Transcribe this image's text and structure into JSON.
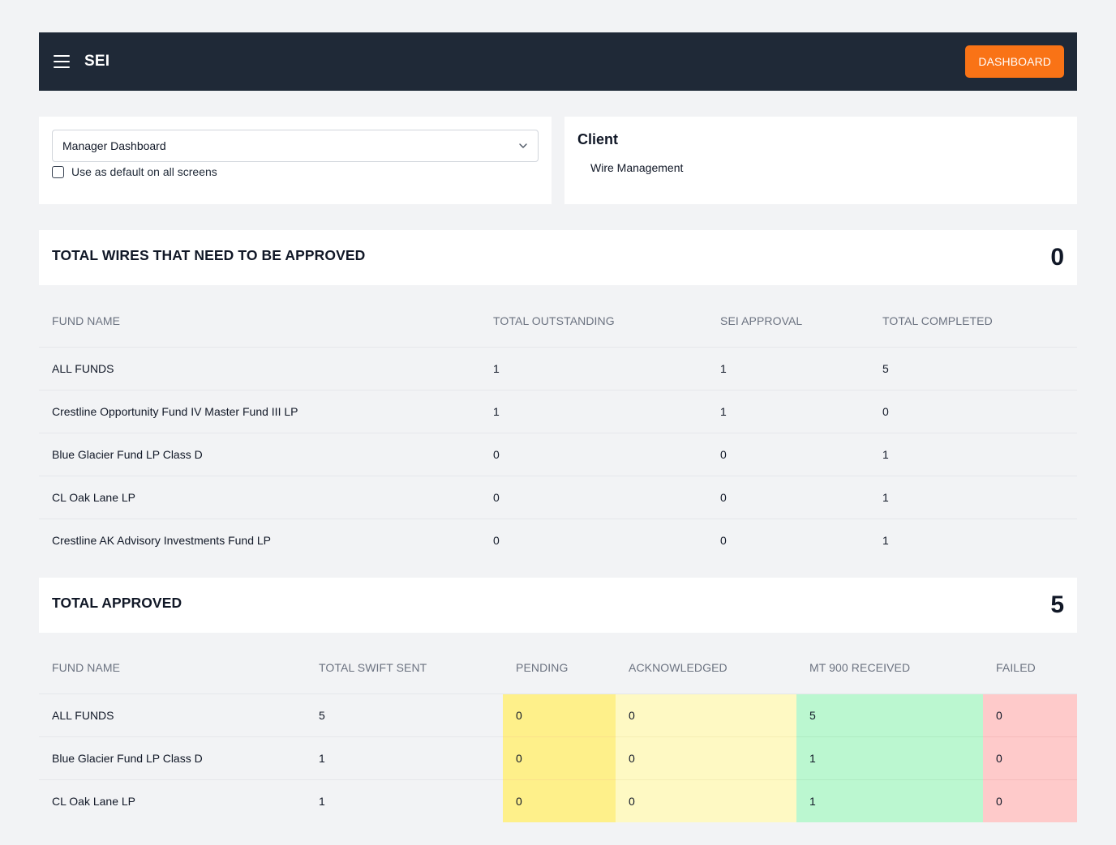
{
  "header": {
    "brand": "SEI",
    "menu_icon": "hamburger-menu-icon",
    "dashboard_label": "DASHBOARD",
    "bar_color": "#1f2937",
    "accent_color": "#f97316"
  },
  "view_selector": {
    "selected": "Manager Dashboard",
    "icon": "chevron-down-icon",
    "default_checkbox_label": "Use as default on all screens",
    "default_checked": false
  },
  "client_panel": {
    "title": "Client",
    "items": [
      "Wire Management"
    ]
  },
  "approval_section": {
    "title": "TOTAL WIRES THAT NEED TO BE APPROVED",
    "count": "0",
    "columns": [
      "FUND NAME",
      "TOTAL OUTSTANDING",
      "SEI APPROVAL",
      "TOTAL COMPLETED"
    ],
    "rows": [
      [
        "ALL FUNDS",
        "1",
        "1",
        "5"
      ],
      [
        "Crestline Opportunity Fund IV Master Fund III LP",
        "1",
        "1",
        "0"
      ],
      [
        "Blue Glacier Fund LP Class D",
        "0",
        "0",
        "1"
      ],
      [
        "CL Oak Lane LP",
        "0",
        "0",
        "1"
      ],
      [
        "Crestline AK Advisory Investments Fund LP",
        "0",
        "0",
        "1"
      ]
    ]
  },
  "approved_section": {
    "title": "TOTAL APPROVED",
    "count": "5",
    "columns": [
      "FUND NAME",
      "TOTAL SWIFT SENT",
      "PENDING",
      "ACKNOWLEDGED",
      "MT 900 RECEIVED",
      "FAILED"
    ],
    "status_colors": {
      "pending": "#fef08a",
      "acknowledged": "#fef9c3",
      "mt900_received": "#bbf7d0",
      "failed": "#fecaca"
    },
    "rows": [
      [
        "ALL FUNDS",
        "5",
        "0",
        "0",
        "5",
        "0"
      ],
      [
        "Blue Glacier Fund LP Class D",
        "1",
        "0",
        "0",
        "1",
        "0"
      ],
      [
        "CL Oak Lane LP",
        "1",
        "0",
        "0",
        "1",
        "0"
      ]
    ]
  }
}
